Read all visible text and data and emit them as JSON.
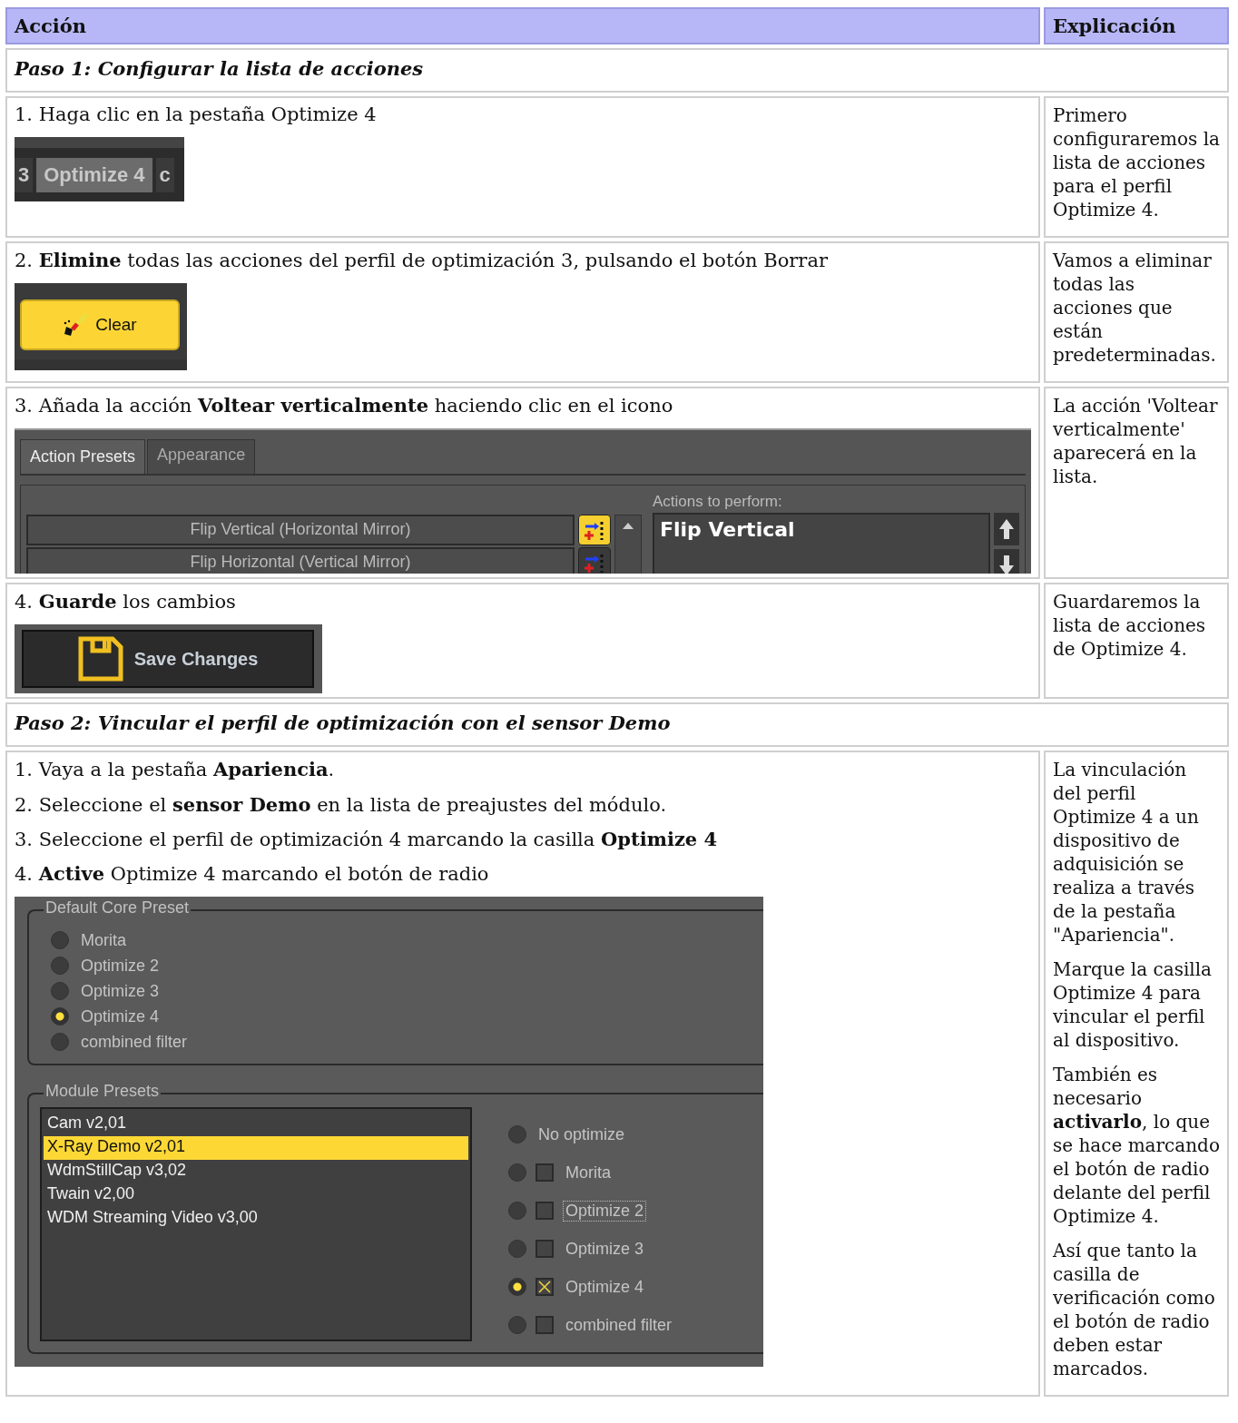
{
  "table": {
    "columns": [
      {
        "label": "Acción"
      },
      {
        "label": "Explicación"
      }
    ],
    "sections": [
      {
        "title": "Paso 1: Configurar la lista de acciones",
        "rows": [
          {
            "steps": [
              "1. Haga clic en la pestaña Optimize 4"
            ],
            "screenshot": {
              "kind": "tab_strip",
              "tabs": [
                {
                  "label": "3",
                  "selected": false
                },
                {
                  "label": "Optimize 4",
                  "selected": true
                },
                {
                  "label": "c",
                  "selected": false
                }
              ]
            },
            "explanation": [
              "Primero configuraremos la lista de acciones para el perfil Optimize 4."
            ]
          },
          {
            "steps": [
              "2. **Elimine** todas las acciones del perfil de optimización 3, pulsando el botón Borrar"
            ],
            "screenshot": {
              "kind": "clear_button",
              "label": "Clear"
            },
            "explanation": [
              "Vamos a eliminar todas las acciones que están predeterminadas."
            ]
          },
          {
            "steps": [
              "3. Añada la acción **Voltear verticalmente** haciendo clic en el icono"
            ],
            "screenshot": {
              "kind": "action_presets",
              "tabs": [
                {
                  "label": "Action Presets",
                  "selected": true
                },
                {
                  "label": "Appearance",
                  "selected": false
                }
              ],
              "presets": [
                {
                  "label": "Flip Vertical (Horizontal Mirror)",
                  "highlighted": true
                },
                {
                  "label": "Flip Horizontal (Vertical Mirror)",
                  "highlighted": false
                }
              ],
              "actions_label": "Actions to perform:",
              "actions": [
                "Flip Vertical"
              ]
            },
            "explanation": [
              "La acción 'Voltear verticalmente' aparecerá en la lista."
            ]
          },
          {
            "steps": [
              "4. **Guarde** los cambios"
            ],
            "screenshot": {
              "kind": "save_button",
              "label": "Save Changes"
            },
            "explanation": [
              "Guardaremos la lista de acciones de Optimize 4."
            ]
          }
        ]
      },
      {
        "title": "Paso 2: Vincular el perfil de optimización con el sensor Demo",
        "rows": [
          {
            "steps": [
              "1. Vaya a la pestaña **Apariencia**.",
              "2. Seleccione el **sensor Demo** en la lista de preajustes del módulo.",
              "3. Seleccione el perfil de optimización 4 marcando la casilla **Optimize 4**",
              "4. **Active** Optimize 4 marcando el botón de radio"
            ],
            "screenshot": {
              "kind": "appearance_panel",
              "core_title": "Default Core Preset",
              "core_options": [
                {
                  "label": "Morita",
                  "selected": false
                },
                {
                  "label": "Optimize 2",
                  "selected": false
                },
                {
                  "label": "Optimize 3",
                  "selected": false
                },
                {
                  "label": "Optimize 4",
                  "selected": true
                },
                {
                  "label": "combined filter",
                  "selected": false
                }
              ],
              "module_title": "Module Presets",
              "modules": [
                {
                  "label": "Cam v2,01",
                  "selected": false
                },
                {
                  "label": "X-Ray Demo v2,01",
                  "selected": true
                },
                {
                  "label": "WdmStillCap v3,02",
                  "selected": false
                },
                {
                  "label": "Twain v2,00",
                  "selected": false
                },
                {
                  "label": "WDM Streaming Video v3,00",
                  "selected": false
                }
              ],
              "profiles": [
                {
                  "kind": "radio",
                  "label": "No optimize",
                  "selected": false
                },
                {
                  "kind": "radio_check",
                  "label": "Morita",
                  "selected": false,
                  "checked": false,
                  "focused": false
                },
                {
                  "kind": "radio_check",
                  "label": "Optimize 2",
                  "selected": false,
                  "checked": false,
                  "focused": true
                },
                {
                  "kind": "radio_check",
                  "label": "Optimize 3",
                  "selected": false,
                  "checked": false,
                  "focused": false
                },
                {
                  "kind": "radio_check",
                  "label": "Optimize 4",
                  "selected": true,
                  "checked": true,
                  "focused": false
                },
                {
                  "kind": "radio_check",
                  "label": "combined filter",
                  "selected": false,
                  "checked": false,
                  "focused": false
                }
              ]
            },
            "explanation": [
              "La vinculación del perfil Optimize 4 a un dispositivo de adquisición se realiza a través de la pestaña \"Apariencia\".",
              "Marque la casilla Optimize 4 para vincular el perfil al dispositivo.",
              "También es necesario **activarlo**, lo que se hace marcando el botón de radio delante del perfil Optimize 4.",
              "Así que tanto la casilla de verificación como el botón de radio deben estar marcados."
            ]
          }
        ]
      }
    ]
  }
}
